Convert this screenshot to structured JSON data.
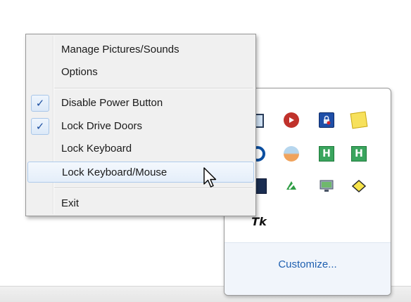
{
  "context_menu": {
    "items": [
      {
        "label": "Manage Pictures/Sounds",
        "checked": false
      },
      {
        "label": "Options",
        "checked": false
      },
      {
        "label": "Disable Power Button",
        "checked": true
      },
      {
        "label": "Lock Drive Doors",
        "checked": true
      },
      {
        "label": "Lock Keyboard",
        "checked": false
      },
      {
        "label": "Lock Keyboard/Mouse",
        "checked": false,
        "highlighted": true
      },
      {
        "label": "Exit",
        "checked": false
      }
    ],
    "check_glyph": "✓"
  },
  "tray_overflow": {
    "icons": [
      "monitor-icon",
      "media-play-icon",
      "lock-icon",
      "sticky-note-icon",
      "circle-icon",
      "orange-sphere-icon",
      "h-icon",
      "h-icon",
      "network-icon",
      "recycle-icon",
      "display-icon",
      "tag-icon",
      "tk-icon"
    ],
    "tk_text": "Tk",
    "customize_label": "Customize..."
  },
  "colors": {
    "menu_bg": "#f0f0f0",
    "highlight_border": "#aecbeb",
    "link": "#1e5fb0",
    "check": "#1d4fa0"
  }
}
